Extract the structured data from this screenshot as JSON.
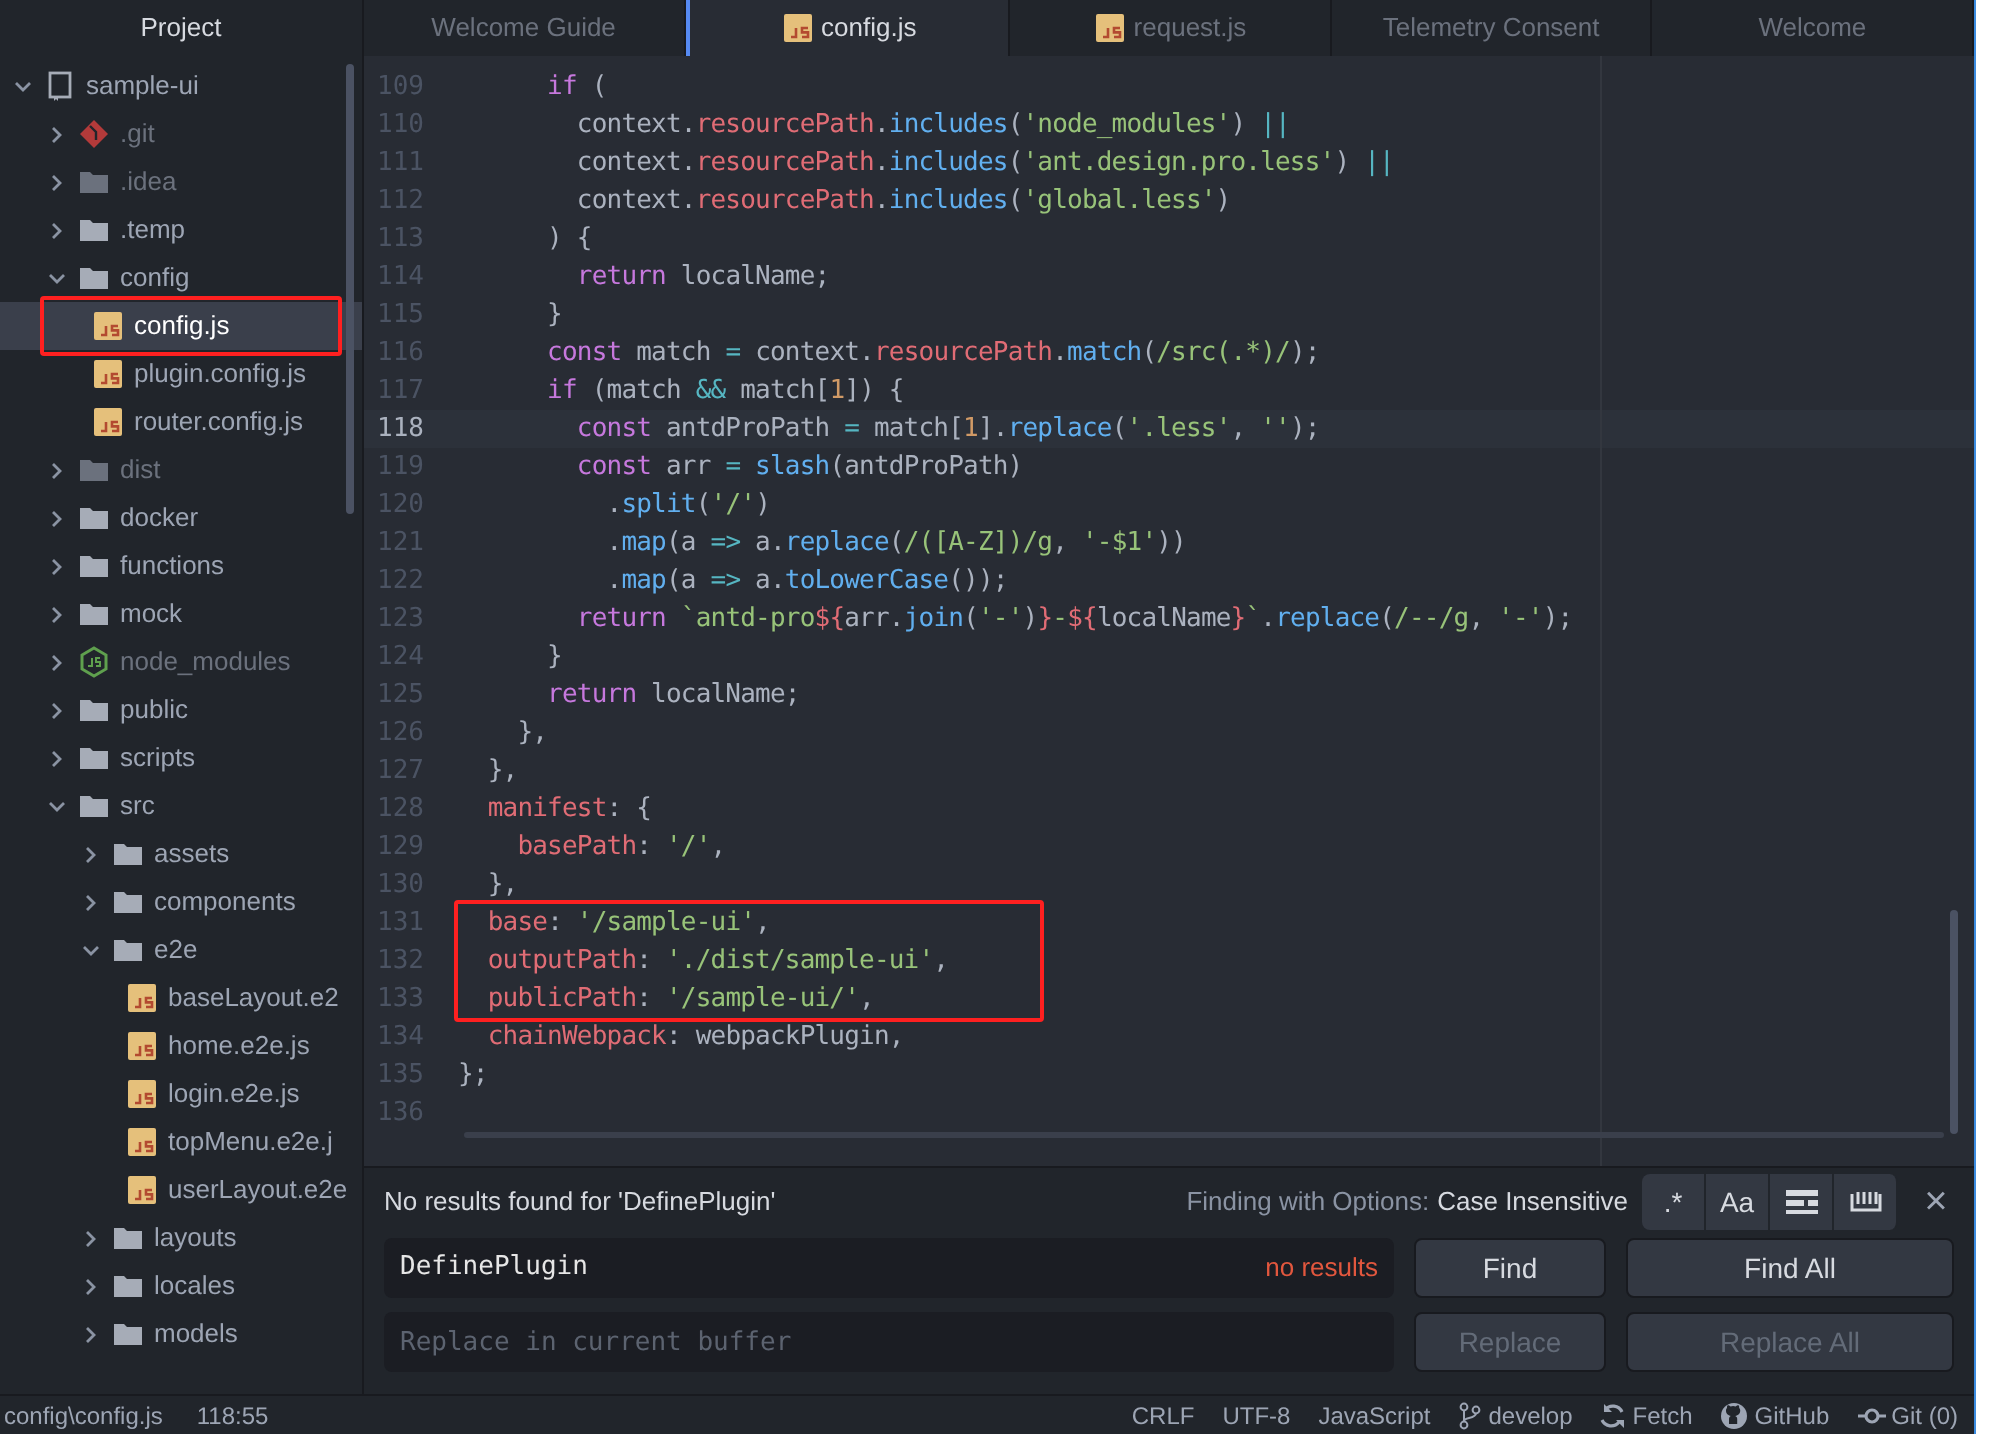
{
  "sidebar": {
    "title": "Project",
    "tree": [
      {
        "label": "sample-ui",
        "kind": "repo",
        "expanded": true,
        "dim": false,
        "selected": false,
        "annotated": false,
        "children": [
          {
            "label": ".git",
            "kind": "git",
            "expanded": false,
            "dim": true,
            "selected": false,
            "annotated": false
          },
          {
            "label": ".idea",
            "kind": "folder",
            "expanded": false,
            "dim": true,
            "selected": false,
            "annotated": false
          },
          {
            "label": ".temp",
            "kind": "folder",
            "expanded": false,
            "dim": false,
            "selected": false,
            "annotated": false
          },
          {
            "label": "config",
            "kind": "folder",
            "expanded": true,
            "dim": false,
            "selected": false,
            "annotated": false,
            "children": [
              {
                "label": "config.js",
                "kind": "js",
                "dim": false,
                "selected": true,
                "annotated": true
              },
              {
                "label": "plugin.config.js",
                "kind": "js",
                "dim": false,
                "selected": false,
                "annotated": false
              },
              {
                "label": "router.config.js",
                "kind": "js",
                "dim": false,
                "selected": false,
                "annotated": false
              }
            ]
          },
          {
            "label": "dist",
            "kind": "folder",
            "expanded": false,
            "dim": true,
            "selected": false,
            "annotated": false
          },
          {
            "label": "docker",
            "kind": "folder",
            "expanded": false,
            "dim": false,
            "selected": false,
            "annotated": false
          },
          {
            "label": "functions",
            "kind": "folder",
            "expanded": false,
            "dim": false,
            "selected": false,
            "annotated": false
          },
          {
            "label": "mock",
            "kind": "folder",
            "expanded": false,
            "dim": false,
            "selected": false,
            "annotated": false
          },
          {
            "label": "node_modules",
            "kind": "node",
            "expanded": false,
            "dim": true,
            "selected": false,
            "annotated": false
          },
          {
            "label": "public",
            "kind": "folder",
            "expanded": false,
            "dim": false,
            "selected": false,
            "annotated": false
          },
          {
            "label": "scripts",
            "kind": "folder",
            "expanded": false,
            "dim": false,
            "selected": false,
            "annotated": false
          },
          {
            "label": "src",
            "kind": "folder",
            "expanded": true,
            "dim": false,
            "selected": false,
            "annotated": false,
            "children": [
              {
                "label": "assets",
                "kind": "folder",
                "expanded": false,
                "dim": false,
                "selected": false,
                "annotated": false
              },
              {
                "label": "components",
                "kind": "folder",
                "expanded": false,
                "dim": false,
                "selected": false,
                "annotated": false
              },
              {
                "label": "e2e",
                "kind": "folder",
                "expanded": true,
                "dim": false,
                "selected": false,
                "annotated": false,
                "children": [
                  {
                    "label": "baseLayout.e2",
                    "kind": "js",
                    "dim": false,
                    "selected": false,
                    "annotated": false
                  },
                  {
                    "label": "home.e2e.js",
                    "kind": "js",
                    "dim": false,
                    "selected": false,
                    "annotated": false
                  },
                  {
                    "label": "login.e2e.js",
                    "kind": "js",
                    "dim": false,
                    "selected": false,
                    "annotated": false
                  },
                  {
                    "label": "topMenu.e2e.j",
                    "kind": "js",
                    "dim": false,
                    "selected": false,
                    "annotated": false
                  },
                  {
                    "label": "userLayout.e2e",
                    "kind": "js",
                    "dim": false,
                    "selected": false,
                    "annotated": false
                  }
                ]
              },
              {
                "label": "layouts",
                "kind": "folder",
                "expanded": false,
                "dim": false,
                "selected": false,
                "annotated": false
              },
              {
                "label": "locales",
                "kind": "folder",
                "expanded": false,
                "dim": false,
                "selected": false,
                "annotated": false
              },
              {
                "label": "models",
                "kind": "folder",
                "expanded": false,
                "dim": false,
                "selected": false,
                "annotated": false
              }
            ]
          }
        ]
      }
    ]
  },
  "tabs": [
    {
      "label": "Welcome Guide",
      "kind": "plain",
      "selected": false
    },
    {
      "label": "config.js",
      "kind": "js",
      "selected": true
    },
    {
      "label": "request.js",
      "kind": "js",
      "selected": false
    },
    {
      "label": "Telemetry Consent",
      "kind": "plain",
      "selected": false
    },
    {
      "label": "Welcome",
      "kind": "plain",
      "selected": false
    }
  ],
  "editor": {
    "lines": [
      {
        "n": "109",
        "current": false,
        "annotated": false,
        "tokens": [
          {
            "kind": "kw",
            "text": "      if"
          },
          {
            "kind": "plain",
            "text": " ("
          }
        ]
      },
      {
        "n": "110",
        "current": false,
        "annotated": false,
        "tokens": [
          {
            "kind": "plain",
            "text": "        context."
          },
          {
            "kind": "prop",
            "text": "resourcePath"
          },
          {
            "kind": "plain",
            "text": "."
          },
          {
            "kind": "fn",
            "text": "includes"
          },
          {
            "kind": "plain",
            "text": "("
          },
          {
            "kind": "str",
            "text": "'node_modules'"
          },
          {
            "kind": "plain",
            "text": ") "
          },
          {
            "kind": "op",
            "text": "||"
          }
        ]
      },
      {
        "n": "111",
        "current": false,
        "annotated": false,
        "tokens": [
          {
            "kind": "plain",
            "text": "        context."
          },
          {
            "kind": "prop",
            "text": "resourcePath"
          },
          {
            "kind": "plain",
            "text": "."
          },
          {
            "kind": "fn",
            "text": "includes"
          },
          {
            "kind": "plain",
            "text": "("
          },
          {
            "kind": "str",
            "text": "'ant.design.pro.less'"
          },
          {
            "kind": "plain",
            "text": ") "
          },
          {
            "kind": "op",
            "text": "||"
          }
        ]
      },
      {
        "n": "112",
        "current": false,
        "annotated": false,
        "tokens": [
          {
            "kind": "plain",
            "text": "        context."
          },
          {
            "kind": "prop",
            "text": "resourcePath"
          },
          {
            "kind": "plain",
            "text": "."
          },
          {
            "kind": "fn",
            "text": "includes"
          },
          {
            "kind": "plain",
            "text": "("
          },
          {
            "kind": "str",
            "text": "'global.less'"
          },
          {
            "kind": "plain",
            "text": ")"
          }
        ]
      },
      {
        "n": "113",
        "current": false,
        "annotated": false,
        "tokens": [
          {
            "kind": "plain",
            "text": "      ) {"
          }
        ]
      },
      {
        "n": "114",
        "current": false,
        "annotated": false,
        "tokens": [
          {
            "kind": "kw",
            "text": "        return"
          },
          {
            "kind": "plain",
            "text": " localName;"
          }
        ]
      },
      {
        "n": "115",
        "current": false,
        "annotated": false,
        "tokens": [
          {
            "kind": "plain",
            "text": "      }"
          }
        ]
      },
      {
        "n": "116",
        "current": false,
        "annotated": false,
        "tokens": [
          {
            "kind": "kw",
            "text": "      const"
          },
          {
            "kind": "plain",
            "text": " match "
          },
          {
            "kind": "op",
            "text": "="
          },
          {
            "kind": "plain",
            "text": " context."
          },
          {
            "kind": "prop",
            "text": "resourcePath"
          },
          {
            "kind": "plain",
            "text": "."
          },
          {
            "kind": "fn",
            "text": "match"
          },
          {
            "kind": "plain",
            "text": "("
          },
          {
            "kind": "str",
            "text": "/src(.*)/"
          },
          {
            "kind": "plain",
            "text": ");"
          }
        ]
      },
      {
        "n": "117",
        "current": false,
        "annotated": false,
        "tokens": [
          {
            "kind": "kw",
            "text": "      if"
          },
          {
            "kind": "plain",
            "text": " (match "
          },
          {
            "kind": "op",
            "text": "&&"
          },
          {
            "kind": "plain",
            "text": " match["
          },
          {
            "kind": "num",
            "text": "1"
          },
          {
            "kind": "plain",
            "text": "]) {"
          }
        ]
      },
      {
        "n": "118",
        "current": true,
        "annotated": false,
        "tokens": [
          {
            "kind": "kw",
            "text": "        const"
          },
          {
            "kind": "plain",
            "text": " antdProPath "
          },
          {
            "kind": "op",
            "text": "="
          },
          {
            "kind": "plain",
            "text": " match["
          },
          {
            "kind": "num",
            "text": "1"
          },
          {
            "kind": "plain",
            "text": "]."
          },
          {
            "kind": "fn",
            "text": "replace"
          },
          {
            "kind": "plain",
            "text": "("
          },
          {
            "kind": "str",
            "text": "'.less'"
          },
          {
            "kind": "plain",
            "text": ", "
          },
          {
            "kind": "str",
            "text": "''"
          },
          {
            "kind": "plain",
            "text": ");"
          }
        ]
      },
      {
        "n": "119",
        "current": false,
        "annotated": false,
        "tokens": [
          {
            "kind": "kw",
            "text": "        const"
          },
          {
            "kind": "plain",
            "text": " arr "
          },
          {
            "kind": "op",
            "text": "="
          },
          {
            "kind": "fn",
            "text": " slash"
          },
          {
            "kind": "plain",
            "text": "(antdProPath)"
          }
        ]
      },
      {
        "n": "120",
        "current": false,
        "annotated": false,
        "tokens": [
          {
            "kind": "plain",
            "text": "          ."
          },
          {
            "kind": "fn",
            "text": "split"
          },
          {
            "kind": "plain",
            "text": "("
          },
          {
            "kind": "str",
            "text": "'/'"
          },
          {
            "kind": "plain",
            "text": ")"
          }
        ]
      },
      {
        "n": "121",
        "current": false,
        "annotated": false,
        "tokens": [
          {
            "kind": "plain",
            "text": "          ."
          },
          {
            "kind": "fn",
            "text": "map"
          },
          {
            "kind": "plain",
            "text": "(a "
          },
          {
            "kind": "op",
            "text": "=>"
          },
          {
            "kind": "plain",
            "text": " a."
          },
          {
            "kind": "fn",
            "text": "replace"
          },
          {
            "kind": "plain",
            "text": "("
          },
          {
            "kind": "str",
            "text": "/([A-Z])/g"
          },
          {
            "kind": "plain",
            "text": ", "
          },
          {
            "kind": "str",
            "text": "'-$1'"
          },
          {
            "kind": "plain",
            "text": "))"
          }
        ]
      },
      {
        "n": "122",
        "current": false,
        "annotated": false,
        "tokens": [
          {
            "kind": "plain",
            "text": "          ."
          },
          {
            "kind": "fn",
            "text": "map"
          },
          {
            "kind": "plain",
            "text": "(a "
          },
          {
            "kind": "op",
            "text": "=>"
          },
          {
            "kind": "plain",
            "text": " a."
          },
          {
            "kind": "fn",
            "text": "toLowerCase"
          },
          {
            "kind": "plain",
            "text": "());"
          }
        ]
      },
      {
        "n": "123",
        "current": false,
        "annotated": false,
        "tokens": [
          {
            "kind": "kw",
            "text": "        return"
          },
          {
            "kind": "str",
            "text": " `antd-pro"
          },
          {
            "kind": "prop",
            "text": "${"
          },
          {
            "kind": "plain",
            "text": "arr."
          },
          {
            "kind": "fn",
            "text": "join"
          },
          {
            "kind": "plain",
            "text": "("
          },
          {
            "kind": "str",
            "text": "'-'"
          },
          {
            "kind": "plain",
            "text": ")"
          },
          {
            "kind": "prop",
            "text": "}"
          },
          {
            "kind": "str",
            "text": "-"
          },
          {
            "kind": "prop",
            "text": "${"
          },
          {
            "kind": "plain",
            "text": "localName"
          },
          {
            "kind": "prop",
            "text": "}"
          },
          {
            "kind": "str",
            "text": "`"
          },
          {
            "kind": "plain",
            "text": "."
          },
          {
            "kind": "fn",
            "text": "replace"
          },
          {
            "kind": "plain",
            "text": "("
          },
          {
            "kind": "str",
            "text": "/--/g"
          },
          {
            "kind": "plain",
            "text": ", "
          },
          {
            "kind": "str",
            "text": "'-'"
          },
          {
            "kind": "plain",
            "text": ");"
          }
        ]
      },
      {
        "n": "124",
        "current": false,
        "annotated": false,
        "tokens": [
          {
            "kind": "plain",
            "text": "      }"
          }
        ]
      },
      {
        "n": "125",
        "current": false,
        "annotated": false,
        "tokens": [
          {
            "kind": "kw",
            "text": "      return"
          },
          {
            "kind": "plain",
            "text": " localName;"
          }
        ]
      },
      {
        "n": "126",
        "current": false,
        "annotated": false,
        "tokens": [
          {
            "kind": "plain",
            "text": "    },"
          }
        ]
      },
      {
        "n": "127",
        "current": false,
        "annotated": false,
        "tokens": [
          {
            "kind": "plain",
            "text": "  },"
          }
        ]
      },
      {
        "n": "128",
        "current": false,
        "annotated": false,
        "tokens": [
          {
            "kind": "prop",
            "text": "  manifest"
          },
          {
            "kind": "plain",
            "text": ": {"
          }
        ]
      },
      {
        "n": "129",
        "current": false,
        "annotated": false,
        "tokens": [
          {
            "kind": "prop",
            "text": "    basePath"
          },
          {
            "kind": "plain",
            "text": ": "
          },
          {
            "kind": "str",
            "text": "'/'"
          },
          {
            "kind": "plain",
            "text": ","
          }
        ]
      },
      {
        "n": "130",
        "current": false,
        "annotated": false,
        "tokens": [
          {
            "kind": "plain",
            "text": "  },"
          }
        ]
      },
      {
        "n": "131",
        "current": false,
        "annotated": true,
        "tokens": [
          {
            "kind": "prop",
            "text": "  base"
          },
          {
            "kind": "plain",
            "text": ": "
          },
          {
            "kind": "str",
            "text": "'/sample-ui'"
          },
          {
            "kind": "plain",
            "text": ","
          }
        ]
      },
      {
        "n": "132",
        "current": false,
        "annotated": true,
        "tokens": [
          {
            "kind": "prop",
            "text": "  outputPath"
          },
          {
            "kind": "plain",
            "text": ": "
          },
          {
            "kind": "str",
            "text": "'./dist/sample-ui'"
          },
          {
            "kind": "plain",
            "text": ","
          }
        ]
      },
      {
        "n": "133",
        "current": false,
        "annotated": true,
        "tokens": [
          {
            "kind": "prop",
            "text": "  publicPath"
          },
          {
            "kind": "plain",
            "text": ": "
          },
          {
            "kind": "str",
            "text": "'/sample-ui/'"
          },
          {
            "kind": "plain",
            "text": ","
          }
        ]
      },
      {
        "n": "134",
        "current": false,
        "annotated": false,
        "tokens": [
          {
            "kind": "prop",
            "text": "  chainWebpack"
          },
          {
            "kind": "plain",
            "text": ": webpackPlugin,"
          }
        ]
      },
      {
        "n": "135",
        "current": false,
        "annotated": false,
        "tokens": [
          {
            "kind": "plain",
            "text": "};"
          }
        ]
      },
      {
        "n": "136",
        "current": false,
        "annotated": false
      }
    ]
  },
  "find_panel": {
    "message": "No results found for 'DefinePlugin'",
    "options_label": "Finding with Options:",
    "options_value": "Case Insensitive",
    "options": [
      {
        "kind": "text",
        "label": ".*"
      },
      {
        "kind": "text",
        "label": "Aa"
      },
      {
        "kind": "selection"
      },
      {
        "kind": "word"
      }
    ],
    "close": "×",
    "find_value": "DefinePlugin",
    "find_status": "no results",
    "replace_placeholder": "Replace in current buffer",
    "buttons": [
      {
        "label": "Find",
        "disabled": false
      },
      {
        "label": "Find All",
        "disabled": false
      }
    ],
    "replace_buttons": [
      {
        "label": "Replace",
        "disabled": true
      },
      {
        "label": "Replace All",
        "disabled": true
      }
    ]
  },
  "status_bar": {
    "file": "config\\config.js",
    "cursor": "118:55",
    "items": [
      {
        "label": "CRLF"
      },
      {
        "label": "UTF-8"
      },
      {
        "label": "JavaScript"
      },
      {
        "label": "develop",
        "kind": "branch"
      },
      {
        "label": "Fetch",
        "kind": "sync"
      },
      {
        "label": "GitHub",
        "kind": "github"
      },
      {
        "label": "Git (0)",
        "kind": "git"
      }
    ]
  }
}
